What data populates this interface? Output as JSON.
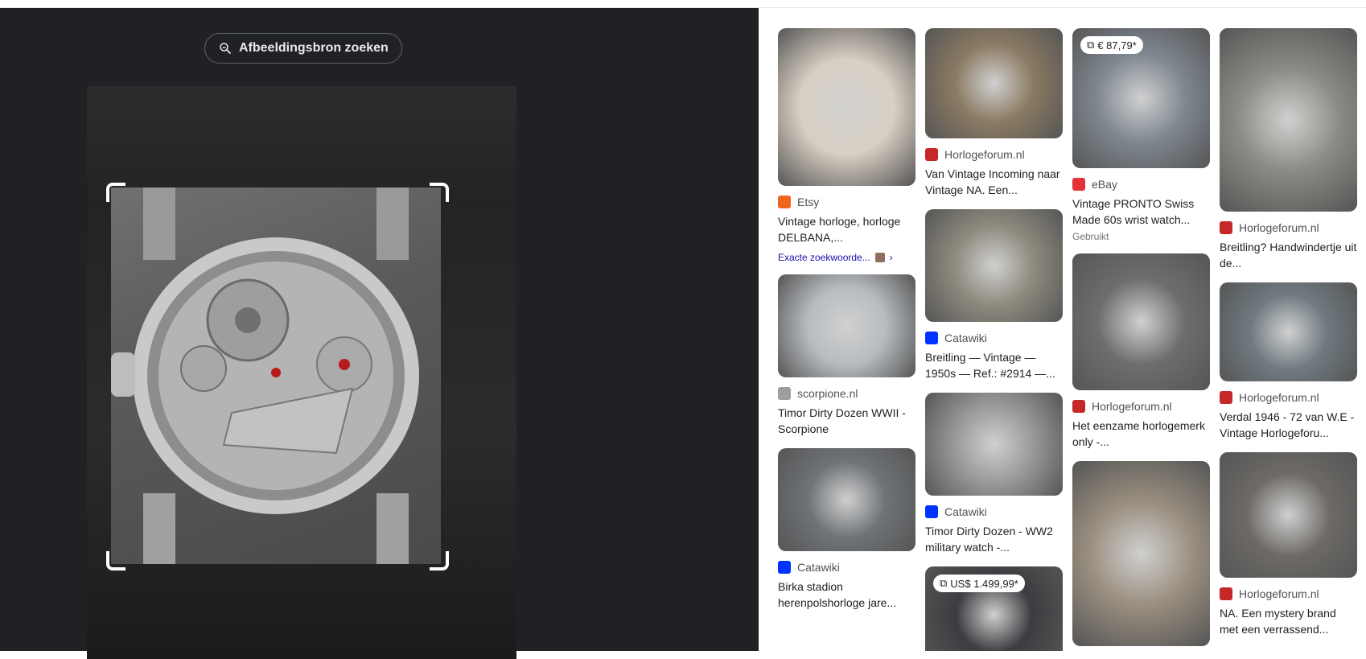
{
  "left_panel": {
    "source_button_label": "Afbeeldingsbron zoeken"
  },
  "results": [
    [
      {
        "source": "Etsy",
        "favicon": "etsy",
        "title": "Vintage horloge, horloge DELBANA,...",
        "exact": "Exacte zoekwoorde...",
        "thumb_h": 196,
        "tone": "#d9cfc3"
      },
      {
        "source": "scorpione.nl",
        "favicon": "scorpione",
        "title": "Timor Dirty Dozen WWII - Scorpione",
        "thumb_h": 128,
        "tone": "#b8bcc0"
      },
      {
        "source": "Catawiki",
        "favicon": "catawiki",
        "title": "Birka stadion herenpolshorloge jare...",
        "thumb_h": 128,
        "tone": "#6f7377"
      }
    ],
    [
      {
        "source": "Horlogeforum.nl",
        "favicon": "horlogeforum",
        "title": "Van Vintage Incoming naar Vintage NA. Een...",
        "thumb_h": 137,
        "tone": "#8a7a62"
      },
      {
        "source": "Catawiki",
        "favicon": "catawiki",
        "title": "Breitling — Vintage — 1950s — Ref.: #2914 —...",
        "thumb_h": 140,
        "tone": "#8e8a7e"
      },
      {
        "source": "Catawiki",
        "favicon": "catawiki",
        "title": "Timor Dirty Dozen - WW2 military watch -...",
        "thumb_h": 128,
        "tone": "#9a9a9a"
      },
      {
        "source": "",
        "favicon": "",
        "title": "",
        "price": "US$ 1.499,99*",
        "thumb_h": 120,
        "tone": "#3b3d40"
      }
    ],
    [
      {
        "source": "eBay",
        "favicon": "ebay",
        "title": "Vintage PRONTO Swiss Made 60s wrist watch...",
        "sub": "Gebruikt",
        "price": "€ 87,79*",
        "thumb_h": 174,
        "tone": "#7f8790"
      },
      {
        "source": "Horlogeforum.nl",
        "favicon": "horlogeforum",
        "title": "Het eenzame horlogemerk only -...",
        "thumb_h": 170,
        "tone": "#6c6e6e"
      },
      {
        "source": "",
        "favicon": "",
        "title": "",
        "thumb_h": 230,
        "tone": "#9a8f80"
      }
    ],
    [
      {
        "source": "Horlogeforum.nl",
        "favicon": "horlogeforum",
        "title": "Breitling? Handwindertje uit de...",
        "thumb_h": 228,
        "tone": "#8b8b85"
      },
      {
        "source": "Horlogeforum.nl",
        "favicon": "horlogeforum",
        "title": "Verdal 1946 - 72 van W.E - Vintage Horlogeforu...",
        "thumb_h": 123,
        "tone": "#6f7a80"
      },
      {
        "source": "Horlogeforum.nl",
        "favicon": "horlogeforum",
        "title": "NA. Een mystery brand met een verrassend...",
        "thumb_h": 156,
        "tone": "#6d6a66"
      }
    ]
  ],
  "colors": {
    "left_bg": "#202124",
    "etsy": "#f1641e",
    "catawiki": "#0033ff",
    "horlogeforum": "#c62828",
    "scorpione": "#9e9e9e",
    "ebay": "#e53238"
  }
}
